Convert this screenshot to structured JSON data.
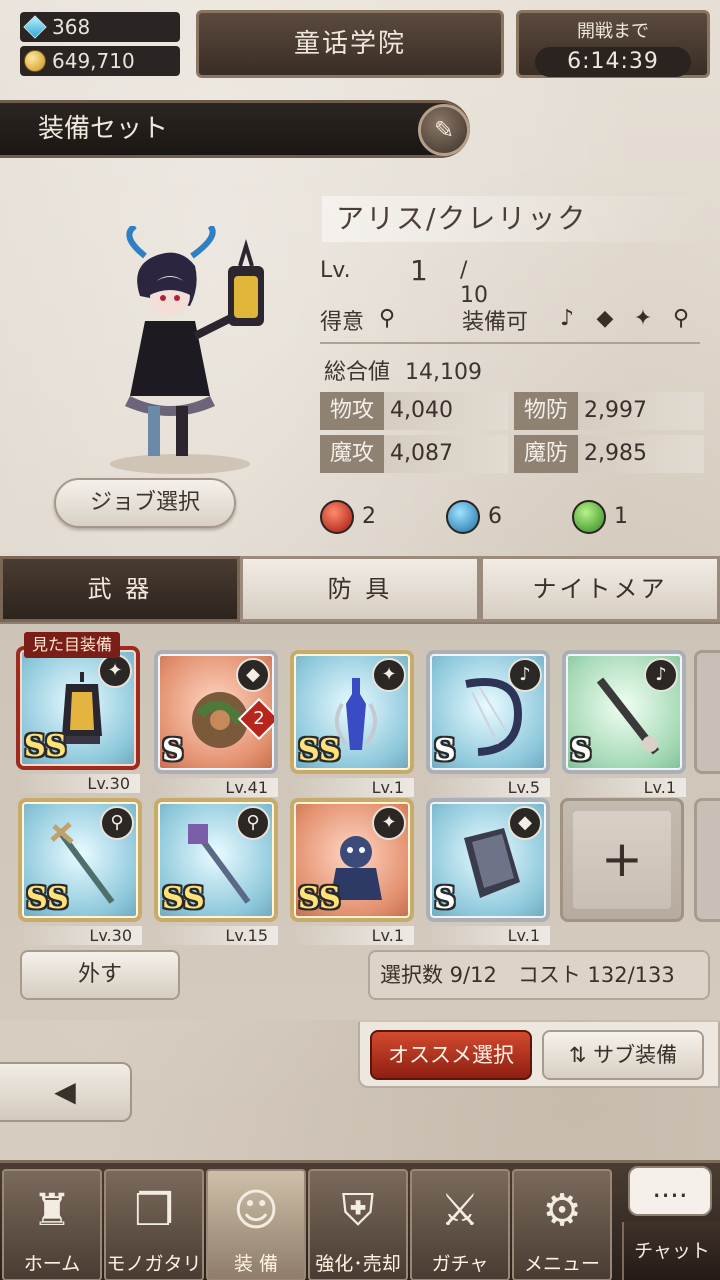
{
  "header": {
    "gems": "368",
    "gold": "649,710",
    "location": "童话学院",
    "timer_label": "開戦まで",
    "timer_value": "6:14:39"
  },
  "equip_set": {
    "title": "装備セット",
    "edit_icon": "pen-icon"
  },
  "character": {
    "name": "アリス/クレリック",
    "lv_label": "Lv.",
    "lv_current": "1",
    "lv_max": "/ 10",
    "specialty_label": "得意",
    "equippable_label": "装備可",
    "total_label": "総合値",
    "total_value": "14,109",
    "job_button": "ジョブ選択",
    "stats": [
      {
        "key": "物攻",
        "value": "4,040"
      },
      {
        "key": "物防",
        "value": "2,997"
      },
      {
        "key": "魔攻",
        "value": "4,087"
      },
      {
        "key": "魔防",
        "value": "2,985"
      }
    ],
    "elements": [
      {
        "icon": "fire-orb-icon",
        "value": "2"
      },
      {
        "icon": "water-orb-icon",
        "value": "6"
      },
      {
        "icon": "wind-orb-icon",
        "value": "1"
      }
    ]
  },
  "tabs": [
    {
      "label": "武 器",
      "active": true
    },
    {
      "label": "防 具",
      "active": false
    },
    {
      "label": "ナイトメア",
      "active": false
    }
  ],
  "look_tag": "見た目装備",
  "slots": [
    {
      "rank": "SS",
      "level": "Lv.30",
      "type_icon": "orb-icon",
      "bg": "blue",
      "frame": "gold",
      "item": "lantern"
    },
    {
      "rank": "S",
      "level": "Lv.41",
      "type_icon": "tome-icon",
      "bg": "red",
      "frame": "silver",
      "item": "tome",
      "badge": "2"
    },
    {
      "rank": "SS",
      "level": "Lv.1",
      "type_icon": "orb-icon",
      "bg": "blue",
      "frame": "gold",
      "item": "vial"
    },
    {
      "rank": "S",
      "level": "Lv.5",
      "type_icon": "harp-icon",
      "bg": "blue",
      "frame": "silver",
      "item": "harp"
    },
    {
      "rank": "S",
      "level": "Lv.1",
      "type_icon": "harp-icon",
      "bg": "green",
      "frame": "silver",
      "item": "flute"
    },
    {
      "rank": "SS",
      "level": "Lv.30",
      "type_icon": "staff-icon",
      "bg": "blue",
      "frame": "gold",
      "item": "staff"
    },
    {
      "rank": "SS",
      "level": "Lv.15",
      "type_icon": "staff-icon",
      "bg": "blue",
      "frame": "gold",
      "item": "staff2"
    },
    {
      "rank": "SS",
      "level": "Lv.1",
      "type_icon": "orb-icon",
      "bg": "red",
      "frame": "gold",
      "item": "doll"
    },
    {
      "rank": "S",
      "level": "Lv.1",
      "type_icon": "tome-icon",
      "bg": "blue",
      "frame": "silver",
      "item": "book"
    }
  ],
  "actions": {
    "remove": "外す",
    "count": "選択数 9/12　コスト 132/133",
    "recommend": "オススメ選択",
    "sub_equip": "サブ装備",
    "add_symbol": "+"
  },
  "nav": [
    {
      "label": "ホーム",
      "icon": "castle-icon",
      "active": false
    },
    {
      "label": "モノガタリ",
      "icon": "book-icon",
      "active": false
    },
    {
      "label": "装 備",
      "icon": "equip-icon",
      "active": true
    },
    {
      "label": "強化･売却",
      "icon": "helmet-icon",
      "active": false
    },
    {
      "label": "ガチャ",
      "icon": "swords-icon",
      "active": false
    },
    {
      "label": "メニュー",
      "icon": "gears-icon",
      "active": false
    }
  ],
  "chat": {
    "label": "チャット",
    "bubble": "...."
  },
  "colors": {
    "accent_red": "#b8261b",
    "panel_dark": "#2a2522",
    "gold_frame": "#c8aa6a"
  }
}
